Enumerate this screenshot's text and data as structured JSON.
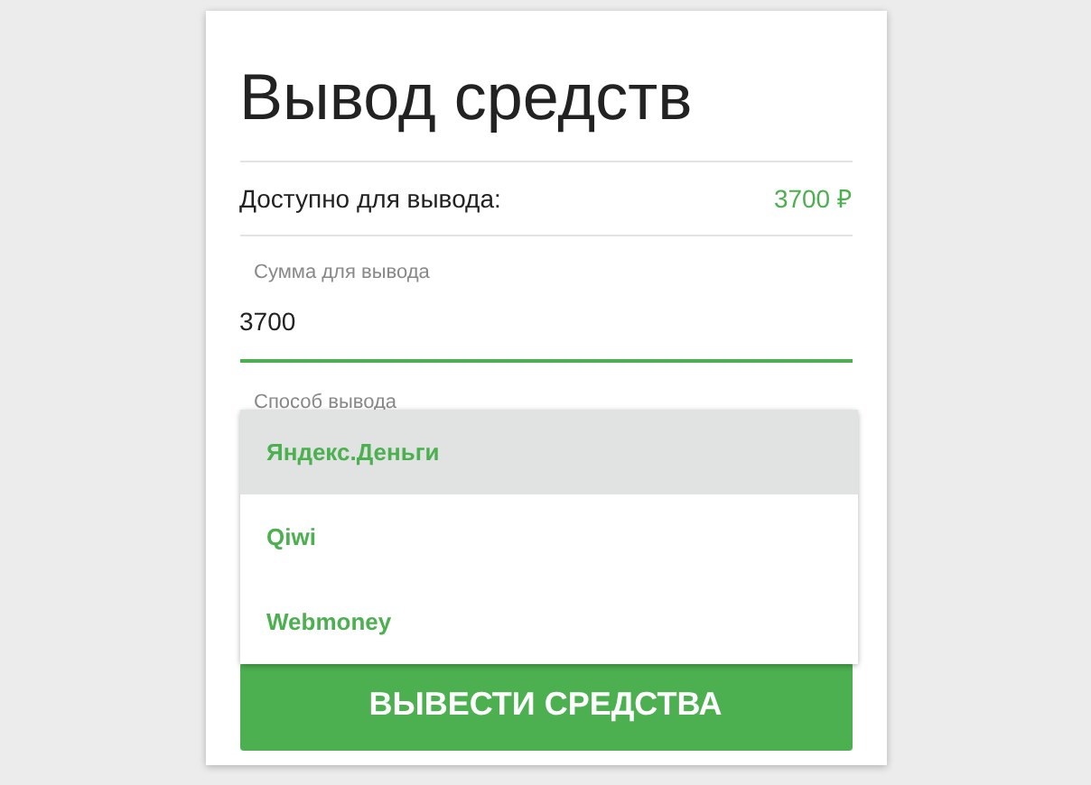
{
  "title": "Вывод средств",
  "available": {
    "label": "Доступно для вывода:",
    "value": "3700 ₽"
  },
  "amount_field": {
    "label": "Сумма для вывода",
    "value": "3700"
  },
  "method_field": {
    "label": "Способ вывода",
    "expanded": true,
    "options": [
      {
        "label": "Яндекс.Деньги",
        "selected": true
      },
      {
        "label": "Qiwi",
        "selected": false
      },
      {
        "label": "Webmoney",
        "selected": false
      }
    ]
  },
  "submit_button": "ВЫВЕСТИ СРЕДСТВА"
}
